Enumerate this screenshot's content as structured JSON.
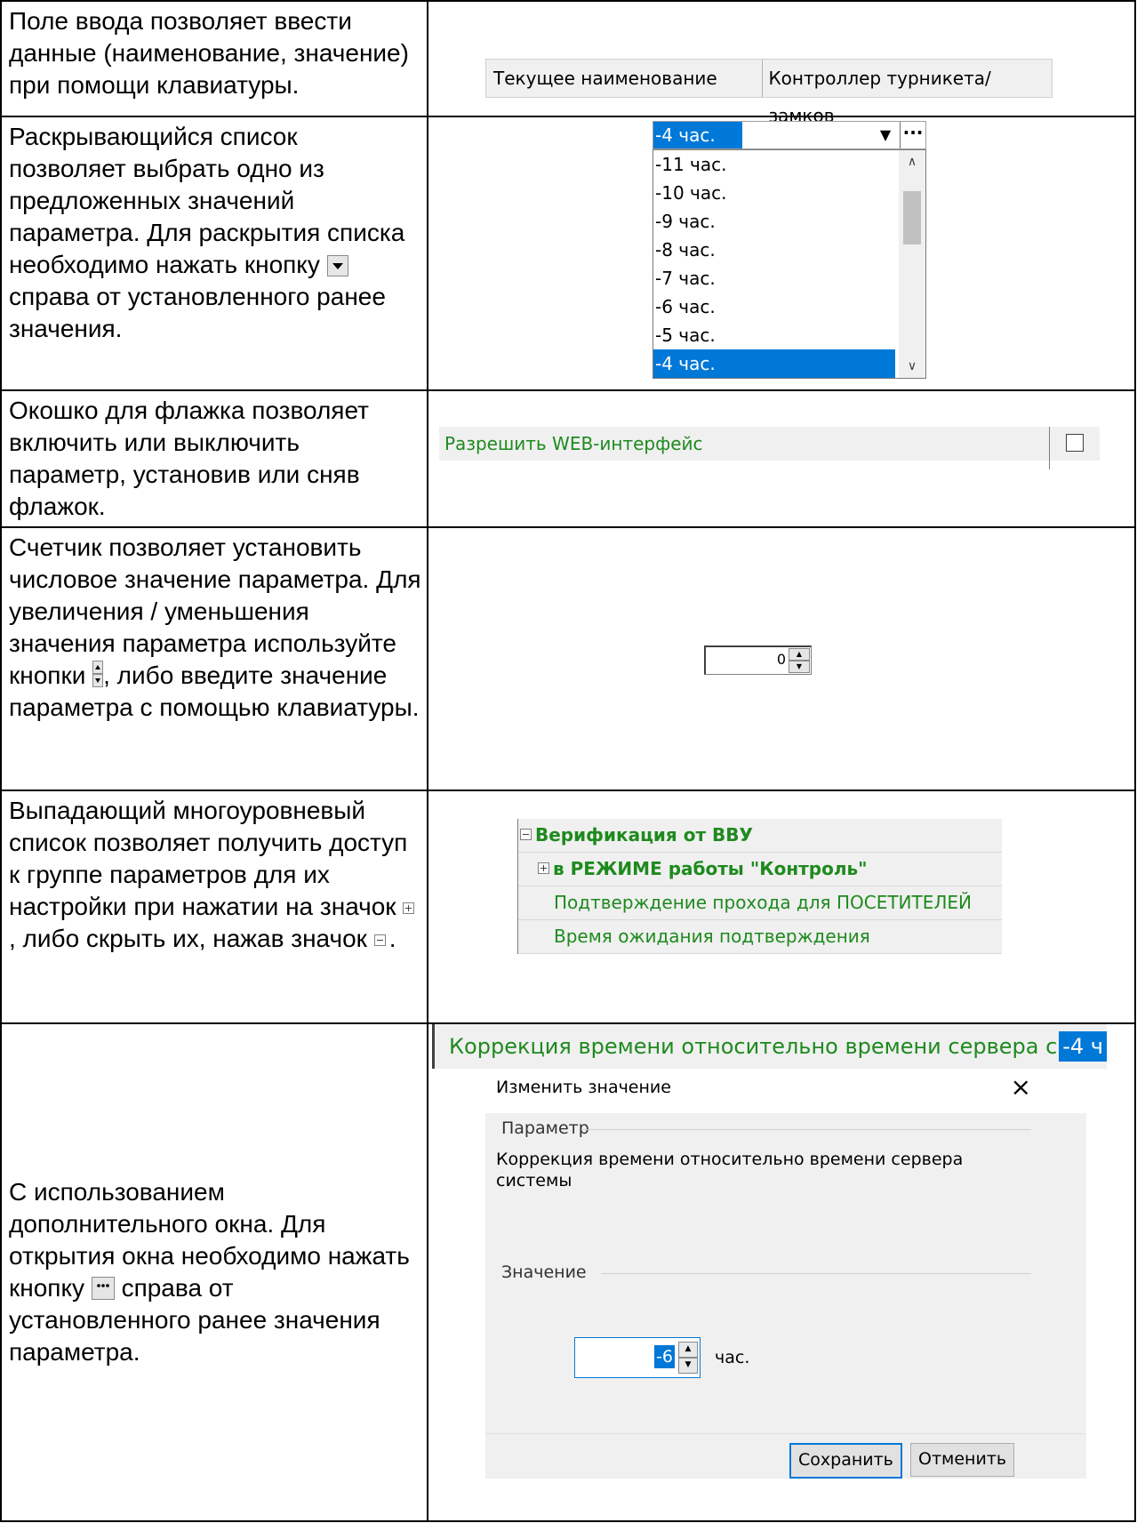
{
  "rows": [
    {
      "description": "Поле ввода позволяет ввести данные (наименование, значение) при помощи клавиатуры.",
      "example": {
        "label": "Текущее наименование",
        "value": "Контроллер турникета/замков"
      }
    },
    {
      "description_parts": [
        "Раскрывающийся список позволяет выбрать одно из предложенных значений параметра. Для раскрытия списка необходимо нажать кнопку ",
        " справа от установленного ранее значения."
      ],
      "example": {
        "selected": "-4 час.",
        "options": [
          "-11 час.",
          "-10 час.",
          "-9 час.",
          "-8 час.",
          "-7 час.",
          "-6 час.",
          "-5 час.",
          "-4 час."
        ],
        "selected_index": 7
      }
    },
    {
      "description": "Окошко для флажка позволяет включить или выключить параметр, установив или сняв флажок.",
      "example": {
        "label": "Разрешить WEB-интерфейс",
        "checked": false
      }
    },
    {
      "description_parts": [
        "Счетчик позволяет установить числовое значение параметра. Для увеличения / уменьшения значения параметра используйте кнопки ",
        ", либо введите значение параметра с помощью клавиатуры."
      ],
      "example": {
        "value": "0"
      }
    },
    {
      "description_parts": [
        "Выпадающий многоуровневый список позволяет получить доступ к группе параметров для их настройки при нажатии на значок ",
        ", либо скрыть их, нажав значок ",
        "."
      ],
      "example": {
        "items": [
          {
            "label": "Верификация от ВВУ",
            "level": 0,
            "expanded": true
          },
          {
            "label": "в РЕЖИМЕ работы \"Контроль\"",
            "level": 1,
            "expanded": false
          },
          {
            "label": "Подтверждение прохода для ПОСЕТИТЕЛЕЙ",
            "level": 2
          },
          {
            "label": "Время ожидания подтверждения",
            "level": 2
          }
        ]
      }
    },
    {
      "description_parts": [
        "С использованием дополнительного окна. Для открытия окна необходимо нажать кнопку ",
        " справа от установленного ранее значения параметра."
      ],
      "example": {
        "strip_label": "Коррекция времени относительно времени сервера системы",
        "strip_value": "-4 ч",
        "dialog_title": "Изменить значение",
        "param_group": "Параметр",
        "param_text": "Коррекция времени относительно времени сервера системы",
        "value_group": "Значение",
        "value": "-6",
        "unit": "час.",
        "save": "Сохранить",
        "cancel": "Отменить"
      }
    }
  ]
}
